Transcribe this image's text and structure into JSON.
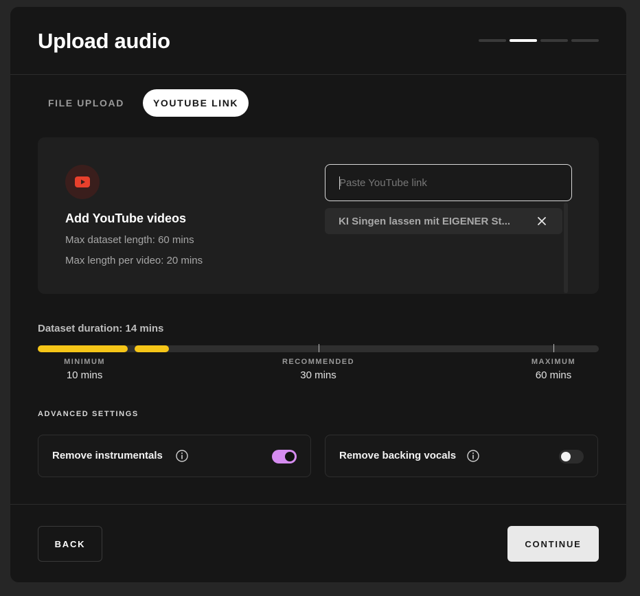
{
  "header": {
    "title": "Upload audio",
    "steps": [
      {
        "active": false
      },
      {
        "active": true
      },
      {
        "active": false
      },
      {
        "active": false
      }
    ]
  },
  "tabs": [
    {
      "label": "FILE UPLOAD",
      "active": false
    },
    {
      "label": "YOUTUBE LINK",
      "active": true
    }
  ],
  "youtube_panel": {
    "icon": "youtube-icon",
    "title": "Add YouTube videos",
    "max_dataset_length": "Max dataset length: 60 mins",
    "max_video_length": "Max length per video: 20 mins",
    "input_placeholder": "Paste YouTube link",
    "input_value": "",
    "videos": [
      {
        "title": "KI Singen lassen mit EIGENER St..."
      }
    ]
  },
  "duration": {
    "label": "Dataset duration: 14 mins",
    "current_mins": 14,
    "max_mins": 60,
    "fill_color": "#f5c518",
    "markers": [
      {
        "label": "MINIMUM",
        "value": "10 mins",
        "mins": 10
      },
      {
        "label": "RECOMMENDED",
        "value": "30 mins",
        "mins": 30
      },
      {
        "label": "MAXIMUM",
        "value": "60 mins",
        "mins": 60
      }
    ]
  },
  "advanced": {
    "title": "ADVANCED SETTINGS",
    "settings": [
      {
        "label": "Remove instrumentals",
        "enabled": true
      },
      {
        "label": "Remove backing vocals",
        "enabled": false
      }
    ],
    "toggle_on_color": "#d58cf0"
  },
  "footer": {
    "back_label": "BACK",
    "continue_label": "CONTINUE"
  }
}
